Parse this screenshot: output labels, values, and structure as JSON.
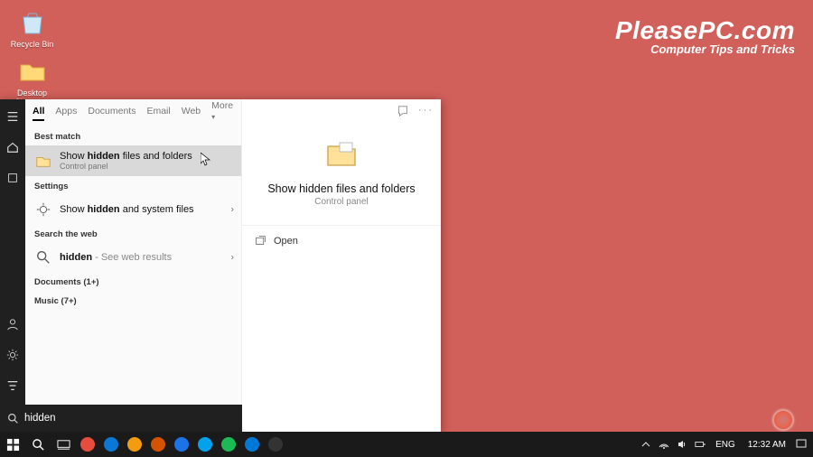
{
  "desktop": {
    "icons": [
      {
        "label": "Recycle Bin"
      },
      {
        "label": "Desktop Shortcuts"
      }
    ],
    "watermark": {
      "title": "PleasePC.com",
      "subtitle": "Computer Tips and Tricks"
    }
  },
  "search": {
    "tabs": [
      "All",
      "Apps",
      "Documents",
      "Email",
      "Web",
      "More"
    ],
    "active_tab": "All",
    "section_best_match": "Best match",
    "best_match": {
      "title_pre": "Show ",
      "title_bold": "hidden",
      "title_post": " files and folders",
      "subtitle": "Control panel"
    },
    "section_settings": "Settings",
    "settings_item": {
      "title_pre": "Show ",
      "title_bold": "hidden",
      "title_post": " and system files"
    },
    "section_web": "Search the web",
    "web_item": {
      "title_bold": "hidden",
      "hint": " - See web results"
    },
    "section_documents": "Documents (1+)",
    "section_music": "Music (7+)",
    "query": "hidden",
    "preview": {
      "title": "Show hidden files and folders",
      "subtitle": "Control panel",
      "action_open": "Open"
    }
  },
  "taskbar": {
    "tray": {
      "lang": "ENG",
      "time": "12:32 AM"
    },
    "apps": [
      {
        "color": "#e74c3c"
      },
      {
        "color": "#0b77d6"
      },
      {
        "color": "#f39c12"
      },
      {
        "color": "#d35400"
      },
      {
        "color": "#1a73e8"
      },
      {
        "color": "#00a2ed"
      },
      {
        "color": "#1db954"
      },
      {
        "color": "#0078d7"
      },
      {
        "color": "#333333"
      }
    ]
  }
}
